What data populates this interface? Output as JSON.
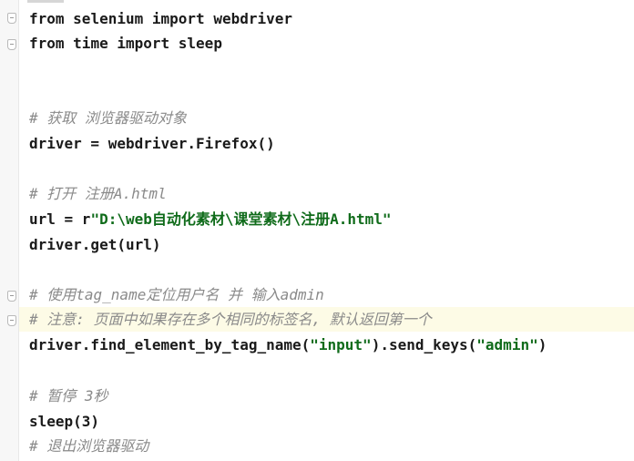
{
  "editor": {
    "lines": {
      "l1": {
        "kw1": "from",
        "mod": "selenium",
        "kw2": "import",
        "name": "webdriver"
      },
      "l2": {
        "kw1": "from",
        "mod": "time",
        "kw2": "import",
        "name": "sleep"
      },
      "l3": {
        "text": "# 获取 浏览器驱动对象"
      },
      "l4": {
        "text": "driver = webdriver.Firefox()"
      },
      "l5": {
        "text": "# 打开 注册A.html"
      },
      "l6": {
        "prefix": "url = r",
        "str": "\"D:\\web自动化素材\\课堂素材\\注册A.html\""
      },
      "l7": {
        "text": "driver.get(url)"
      },
      "l8": {
        "text": "# 使用tag_name定位用户名 并 输入admin"
      },
      "l9": {
        "text": "# 注意: 页面中如果存在多个相同的标签名, 默认返回第一个"
      },
      "l10": {
        "p1": "driver.find_element_by_tag_name(",
        "s1": "\"input\"",
        "p2": ").send_keys(",
        "s2": "\"admin\"",
        "p3": ")"
      },
      "l11": {
        "text": "# 暂停 3秒"
      },
      "l12": {
        "text": "sleep(3)"
      },
      "l13": {
        "text": "# 退出浏览器驱动"
      }
    }
  }
}
